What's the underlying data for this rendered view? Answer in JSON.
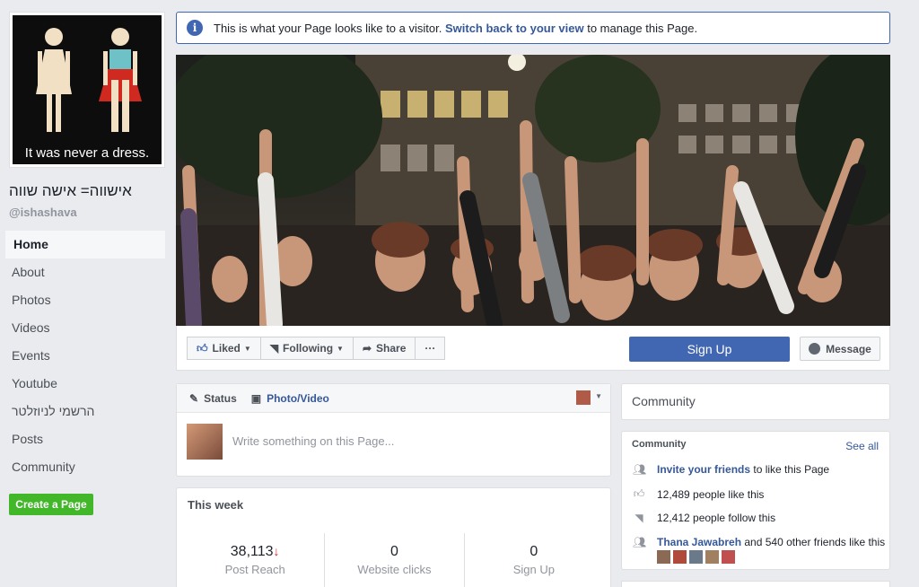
{
  "sidebar": {
    "profile_caption": "It was never a dress.",
    "page_name": "אישווה= אישה שווה",
    "handle": "@ishashava",
    "nav": [
      {
        "label": "Home",
        "active": true
      },
      {
        "label": "About"
      },
      {
        "label": "Photos"
      },
      {
        "label": "Videos"
      },
      {
        "label": "Events"
      },
      {
        "label": "Youtube"
      },
      {
        "label": "הרשמי לניוזלטר"
      },
      {
        "label": "Posts"
      },
      {
        "label": "Community"
      }
    ],
    "create_page": "Create a Page"
  },
  "notice": {
    "before": "This is what your Page looks like to a visitor.",
    "link": "Switch back to your view",
    "after": "to manage this Page."
  },
  "actions": {
    "liked": "Liked",
    "following": "Following",
    "share": "Share",
    "more": "···",
    "sign_up": "Sign Up",
    "message": "Message"
  },
  "composer": {
    "status": "Status",
    "photo_video": "Photo/Video",
    "placeholder": "Write something on this Page..."
  },
  "this_week": {
    "title": "This week",
    "stats": [
      {
        "value": "38,113",
        "label": "Post Reach",
        "trend": "↓"
      },
      {
        "value": "0",
        "label": "Website clicks"
      },
      {
        "value": "0",
        "label": "Sign Up"
      }
    ]
  },
  "community": {
    "header": "Community",
    "title": "Community",
    "see_all": "See all",
    "invite_link": "Invite your friends",
    "invite_rest": "to like this Page",
    "likes": "12,489 people like this",
    "follows": "12,412 people follow this",
    "friend_name": "Thana Jawabreh",
    "friend_rest": "and 540 other friends like this"
  },
  "colors": {
    "fb_blue": "#4267b2",
    "link": "#365899",
    "green": "#42b72a",
    "background": "#e9ebee"
  }
}
